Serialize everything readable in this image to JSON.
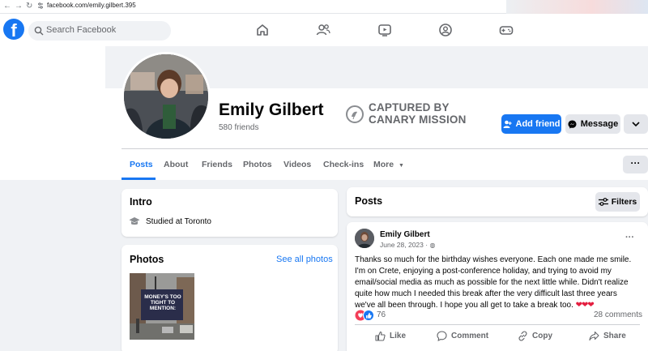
{
  "browser": {
    "url": "facebook.com/emily.gilbert.395"
  },
  "topnav": {
    "logo": "f",
    "search_placeholder": "Search Facebook",
    "icons": [
      "home-icon",
      "friends-icon",
      "watch-icon",
      "groups-icon",
      "gaming-icon"
    ]
  },
  "profile": {
    "name": "Emily Gilbert",
    "friends": "580 friends",
    "overlay_line1": "CAPTURED BY",
    "overlay_line2": "CANARY MISSION",
    "add_friend": "Add friend",
    "message": "Message"
  },
  "tabs": [
    {
      "label": "Posts",
      "active": true
    },
    {
      "label": "About",
      "active": false
    },
    {
      "label": "Friends",
      "active": false
    },
    {
      "label": "Photos",
      "active": false
    },
    {
      "label": "Videos",
      "active": false
    },
    {
      "label": "Check-ins",
      "active": false
    },
    {
      "label": "More",
      "active": false
    }
  ],
  "intro": {
    "title": "Intro",
    "studied": "Studied at Toronto"
  },
  "photos": {
    "title": "Photos",
    "see_all": "See all photos",
    "thumb_caption": "MONEY'S TOO TIGHT TO MENTION:"
  },
  "posts": {
    "title": "Posts",
    "filters": "Filters"
  },
  "post": {
    "author": "Emily Gilbert",
    "date": "June 28, 2023 · ",
    "text": "Thanks so much for the birthday wishes everyone. Each one made me smile. I'm on Crete, enjoying a post-conference holiday, and trying to avoid my email/social media as much as possible for the next little while. Didn't realize quite how much I needed this break after the very difficult last three years we've all been through. I hope you all get to take a break too.  ",
    "hearts": "❤❤❤",
    "reaction_count": "76",
    "comments": "28 comments",
    "actions": {
      "like": "Like",
      "comment": "Comment",
      "copy": "Copy",
      "share": "Share"
    }
  },
  "colors": {
    "brand": "#1877f2",
    "background": "#f0f2f5",
    "secondary_text": "#65676b"
  }
}
